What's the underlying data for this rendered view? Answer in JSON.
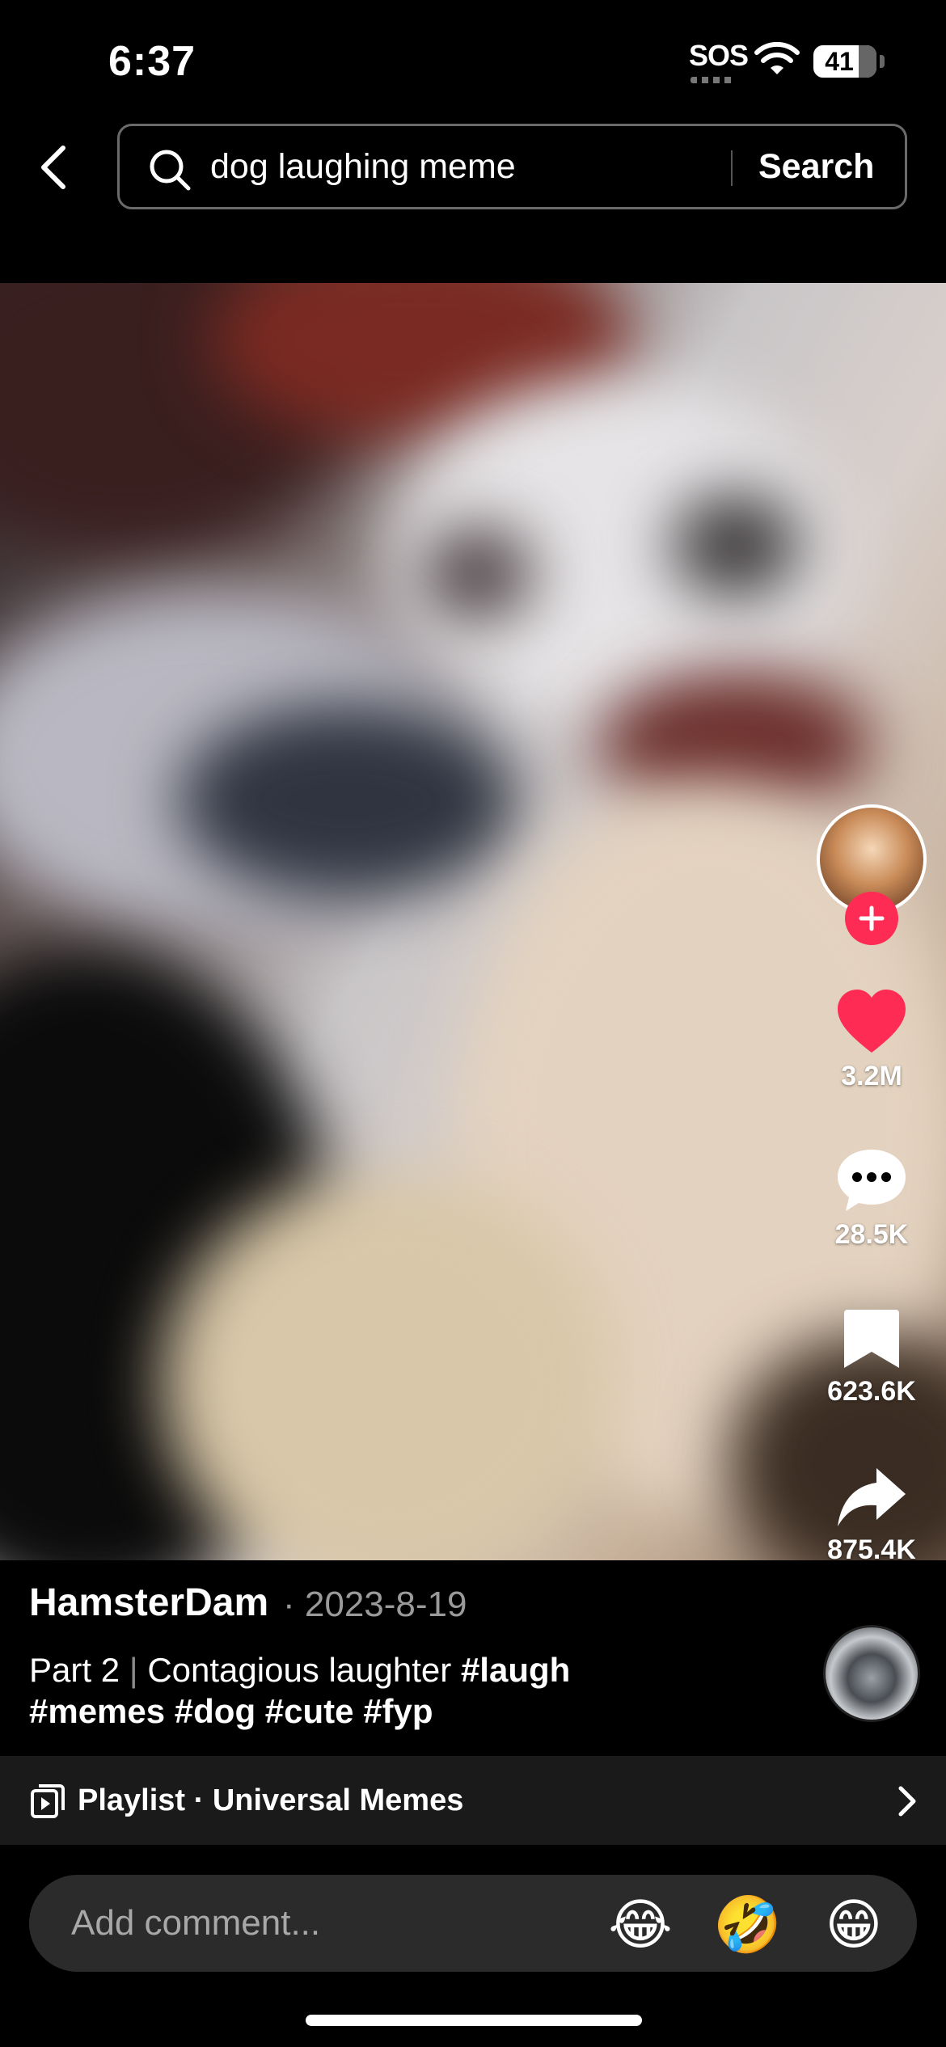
{
  "status_bar": {
    "time": "6:37",
    "sos": "SOS",
    "battery": "41"
  },
  "search": {
    "query": "dog laughing meme",
    "button_label": "Search"
  },
  "actions": {
    "likes": "3.2M",
    "comments": "28.5K",
    "saves": "623.6K",
    "shares": "875.4K"
  },
  "post": {
    "username": "HamsterDam",
    "date": "· 2023-8-19",
    "caption_lead": "Part 2",
    "caption_sep": "|",
    "caption_text": "Contagious laughter",
    "hashtags": [
      "#laugh",
      "#memes",
      "#dog",
      "#cute",
      "#fyp"
    ]
  },
  "playlist": {
    "label": "Playlist · Universal Memes"
  },
  "comment": {
    "placeholder": "Add comment...",
    "emojis": [
      "😂",
      "🤣",
      "😁"
    ]
  },
  "colors": {
    "like_red": "#fe2c55",
    "background": "#000000",
    "comment_bar": "#2b2b2b"
  }
}
